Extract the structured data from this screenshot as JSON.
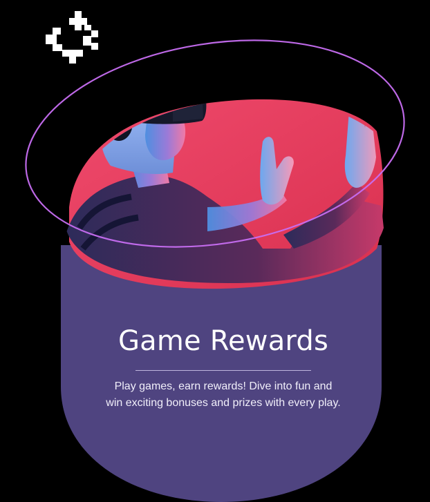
{
  "card": {
    "title": "Game Rewards",
    "description": "Play games, earn rewards! Dive into fun and win exciting bonuses and prizes with every play."
  },
  "colors": {
    "background": "#000000",
    "card_purple": "#4f4480",
    "accent_pink": "#e63b63",
    "ring_violet": "#c76ef2",
    "light_blue": "#5fa6f0"
  },
  "icons": {
    "decorative_mark": "pixel-cross-arrow-icon"
  },
  "image": {
    "subject": "person wearing a virtual reality headset"
  }
}
